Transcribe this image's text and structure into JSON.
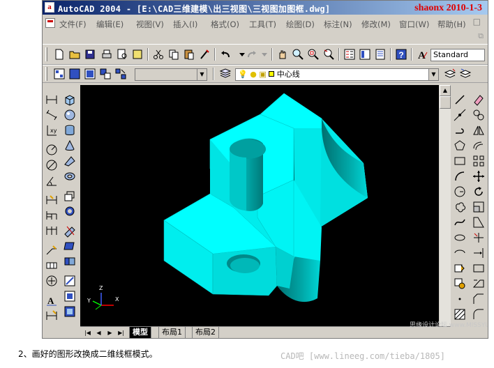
{
  "window": {
    "title": "AutoCAD 2004 - [E:\\CAD三维建模\\出三视图\\三视图加图框.dwg]",
    "app_icon": "a",
    "watermark": "shaonx 2010-1-3"
  },
  "menu": [
    "文件(F)",
    "编辑(E)",
    "视图(V)",
    "插入(I)",
    "格式(O)",
    "工具(T)",
    "绘图(D)",
    "标注(N)",
    "修改(M)",
    "窗口(W)",
    "帮助(H)"
  ],
  "toolbar": {
    "textstyle": "Standard",
    "layer_name": "中心线"
  },
  "tabs": [
    "模型",
    "布局1",
    "布局2"
  ],
  "ucs": {
    "x": "X",
    "y": "Y",
    "z": "Z"
  },
  "caption": "2、画好的图形改换成二维线框模式。",
  "credit": "CAD吧 [www.lineeg.com/tieba/1805]",
  "credit_small": "思缘设计论坛 www.MISSYUAN.COM",
  "colors": {
    "solid": "#00ffff",
    "canvas": "#000000",
    "chrome": "#d4d0c8"
  }
}
